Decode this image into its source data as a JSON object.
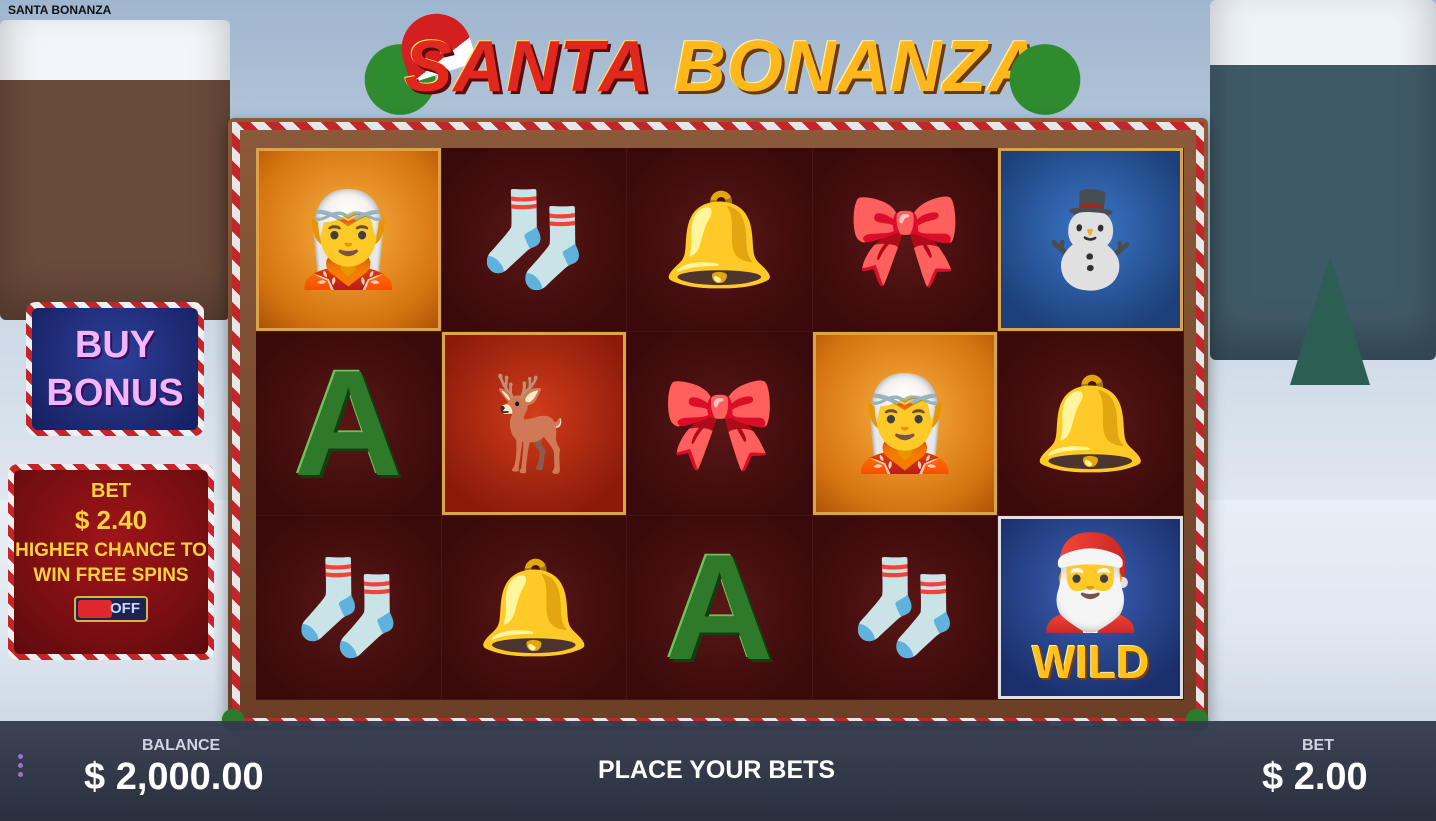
{
  "window": {
    "title": "SANTA BONANZA"
  },
  "logo": {
    "word1": "SANTA",
    "word2": "BONANZA"
  },
  "buy_bonus": {
    "line1": "BUY",
    "line2": "BONUS"
  },
  "bet_panel": {
    "label": "BET",
    "amount": "$ 2.40",
    "description": "HIGHER CHANCE TO WIN FREE SPINS",
    "toggle_label": "OFF"
  },
  "reels": [
    [
      "elf",
      "stocking",
      "bell",
      "bow",
      "snowman"
    ],
    [
      "letter-a",
      "reindeer",
      "bow",
      "elf",
      "bell"
    ],
    [
      "stocking",
      "bell",
      "letter-a",
      "stocking",
      "santa-wild"
    ]
  ],
  "symbol_text": {
    "letter_a": "A",
    "wild": "WILD"
  },
  "footer": {
    "balance_label": "BALANCE",
    "balance_value": "$ 2,000.00",
    "status": "PLACE YOUR BETS",
    "bet_label": "BET",
    "bet_value": "$ 2.00"
  }
}
